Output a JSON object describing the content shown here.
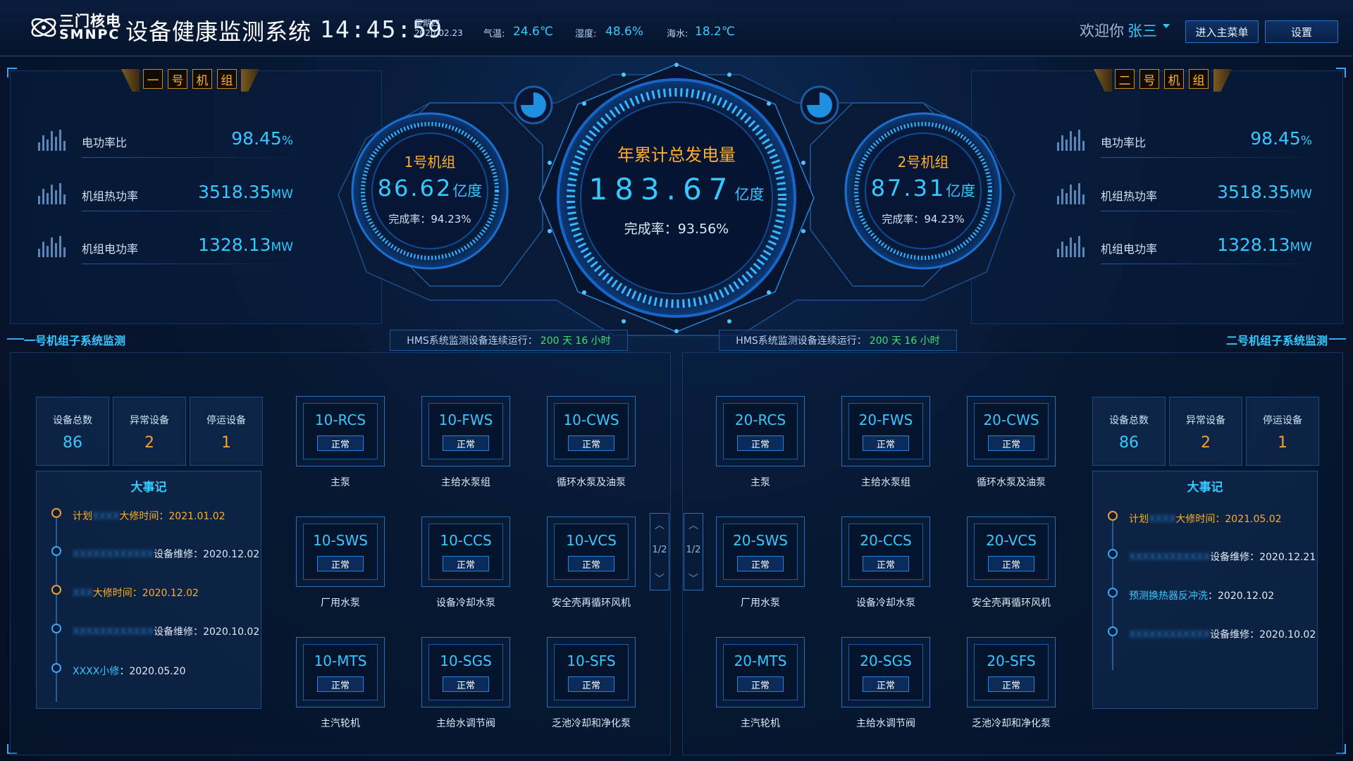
{
  "header": {
    "logo_cn": "三门核电",
    "logo_en": "SMNPC",
    "system_title": "设备健康监测系统",
    "time": "14:45:59",
    "weekday": "星期四",
    "date": "2020.02.23",
    "temp_label": "气温:",
    "temp_value": "24.6℃",
    "humidity_label": "湿度:",
    "humidity_value": "48.6%",
    "sea_label": "海水:",
    "sea_value": "18.2℃",
    "welcome": "欢迎你",
    "user": "张三",
    "menu_button": "进入主菜单",
    "settings_button": "设置"
  },
  "unit1": {
    "tag": [
      "一",
      "号",
      "机",
      "组"
    ],
    "stats": [
      {
        "label": "电功率比",
        "value": "98.45",
        "unit": "%"
      },
      {
        "label": "机组热功率",
        "value": "3518.35",
        "unit": "MW"
      },
      {
        "label": "机组电功率",
        "value": "1328.13",
        "unit": "MW"
      }
    ],
    "section_title": "一号机组子系统监测",
    "hms_label": "HMS系统监测设备连续运行：",
    "hms_value": "200 天 16 小时",
    "counts": [
      {
        "label": "设备总数",
        "value": "86",
        "color": "#37c8ff"
      },
      {
        "label": "异常设备",
        "value": "2",
        "color": "#f0a030"
      },
      {
        "label": "停运设备",
        "value": "1",
        "color": "#f0a030"
      }
    ],
    "events_title": "大事记",
    "events": [
      {
        "prefix": "计划",
        "masked": "XXXX",
        "text": "大修时间：2021.01.02",
        "highlight": true
      },
      {
        "prefix": "",
        "masked": "XXXXXXXXXXXX",
        "text": "设备维修：2020.12.02",
        "highlight": false
      },
      {
        "prefix": "",
        "masked": "XXX",
        "text": "大修时间：2020.12.02",
        "highlight": true
      },
      {
        "prefix": "",
        "masked": "XXXXXXXXXXXX",
        "text": "设备维修：2020.10.02",
        "highlight": false
      },
      {
        "prefix": "XXXX小修",
        "masked": "",
        "text": "：2020.05.20",
        "highlight": false
      }
    ],
    "equipment": [
      {
        "code": "10-RCS",
        "status": "正常",
        "name": "主泵"
      },
      {
        "code": "10-FWS",
        "status": "正常",
        "name": "主给水泵组"
      },
      {
        "code": "10-CWS",
        "status": "正常",
        "name": "循环水泵及油泵"
      },
      {
        "code": "10-SWS",
        "status": "正常",
        "name": "厂用水泵"
      },
      {
        "code": "10-CCS",
        "status": "正常",
        "name": "设备冷却水泵"
      },
      {
        "code": "10-VCS",
        "status": "正常",
        "name": "安全壳再循环风机"
      },
      {
        "code": "10-MTS",
        "status": "正常",
        "name": "主汽轮机"
      },
      {
        "code": "10-SGS",
        "status": "正常",
        "name": "主给水调节阀"
      },
      {
        "code": "10-SFS",
        "status": "正常",
        "name": "乏池冷却和净化泵"
      }
    ],
    "pager": "1/2"
  },
  "unit2": {
    "tag": [
      "二",
      "号",
      "机",
      "组"
    ],
    "stats": [
      {
        "label": "电功率比",
        "value": "98.45",
        "unit": "%"
      },
      {
        "label": "机组热功率",
        "value": "3518.35",
        "unit": "MW"
      },
      {
        "label": "机组电功率",
        "value": "1328.13",
        "unit": "MW"
      }
    ],
    "section_title": "二号机组子系统监测",
    "hms_label": "HMS系统监测设备连续运行：",
    "hms_value": "200 天 16 小时",
    "counts": [
      {
        "label": "设备总数",
        "value": "86",
        "color": "#37c8ff"
      },
      {
        "label": "异常设备",
        "value": "2",
        "color": "#f0a030"
      },
      {
        "label": "停运设备",
        "value": "1",
        "color": "#f0a030"
      }
    ],
    "events_title": "大事记",
    "events": [
      {
        "prefix": "计划",
        "masked": "XXXX",
        "text": "大修时间：2021.05.02",
        "highlight": true
      },
      {
        "prefix": "",
        "masked": "XXXXXXXXXXXX",
        "text": "设备维修：2020.12.21",
        "highlight": false
      },
      {
        "prefix": "预测换热器反冲洗",
        "masked": "",
        "text": "：2020.12.02",
        "highlight": false
      },
      {
        "prefix": "",
        "masked": "XXXXXXXXXXXX",
        "text": "设备维修：2020.10.02",
        "highlight": false
      }
    ],
    "equipment": [
      {
        "code": "20-RCS",
        "status": "正常",
        "name": "主泵"
      },
      {
        "code": "20-FWS",
        "status": "正常",
        "name": "主给水泵组"
      },
      {
        "code": "20-CWS",
        "status": "正常",
        "name": "循环水泵及油泵"
      },
      {
        "code": "20-SWS",
        "status": "正常",
        "name": "厂用水泵"
      },
      {
        "code": "20-CCS",
        "status": "正常",
        "name": "设备冷却水泵"
      },
      {
        "code": "20-VCS",
        "status": "正常",
        "name": "安全壳再循环风机"
      },
      {
        "code": "20-MTS",
        "status": "正常",
        "name": "主汽轮机"
      },
      {
        "code": "20-SGS",
        "status": "正常",
        "name": "主给水调节阀"
      },
      {
        "code": "20-SFS",
        "status": "正常",
        "name": "乏池冷却和净化泵"
      }
    ],
    "pager": "1/2"
  },
  "gauges": {
    "left": {
      "title": "1号机组",
      "value": "86.62",
      "unit": "亿度",
      "rate": "完成率：94.23%"
    },
    "center": {
      "title": "年累计总发电量",
      "value": "183.67",
      "unit": "亿度",
      "rate": "完成率：93.56%"
    },
    "right": {
      "title": "2号机组",
      "value": "87.31",
      "unit": "亿度",
      "rate": "完成率：94.23%"
    }
  },
  "colors": {
    "accent": "#37c8ff",
    "warning": "#f0a030",
    "running": "#3be36c",
    "title_orange": "#ffae2b"
  }
}
